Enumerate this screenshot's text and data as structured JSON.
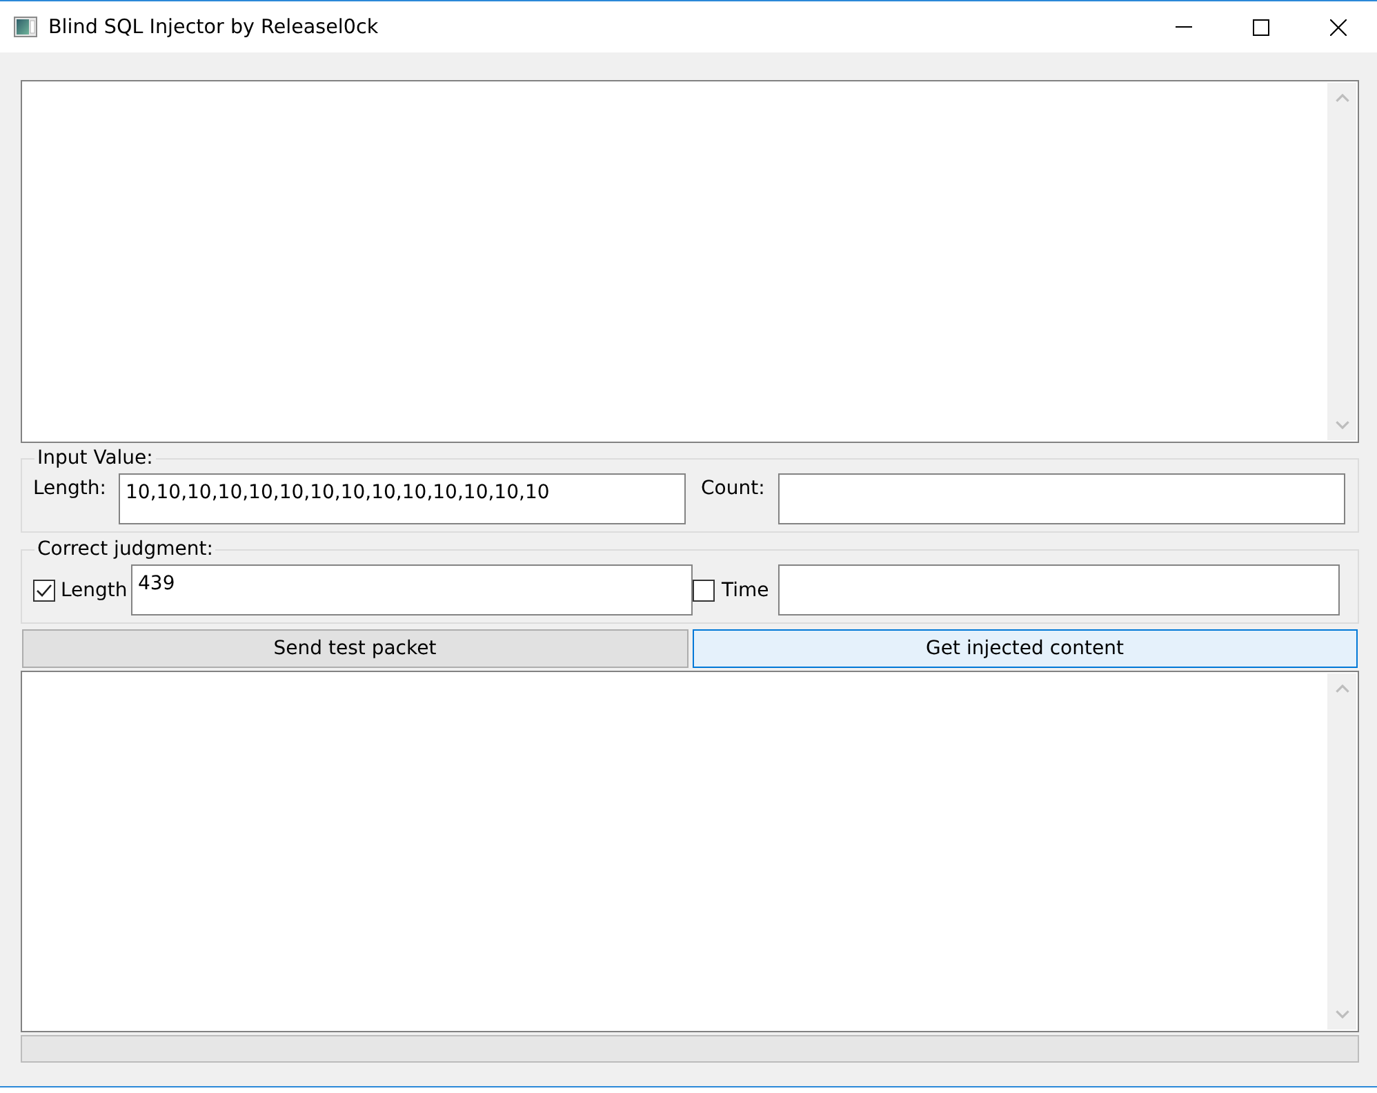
{
  "window": {
    "title": "Blind SQL Injector by Releasel0ck"
  },
  "input_value": {
    "title": "Input Value:",
    "length": {
      "label": "Length:",
      "value": "10,10,10,10,10,10,10,10,10,10,10,10,10,10"
    },
    "count": {
      "label": "Count:"
    }
  },
  "correct_judgment": {
    "title": "Correct judgment:",
    "length": {
      "label": "Length",
      "checked": true,
      "value": "439"
    },
    "time": {
      "label": "Time",
      "checked": false
    }
  },
  "buttons": [
    {
      "label": "Send test packet",
      "focused": false
    },
    {
      "label": "Get injected content",
      "focused": true
    }
  ],
  "progress": {
    "level": 0
  }
}
